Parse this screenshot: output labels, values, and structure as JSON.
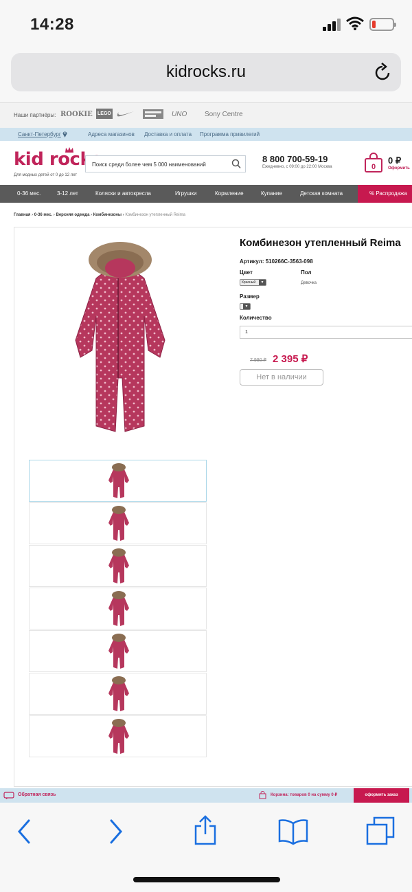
{
  "status": {
    "time": "14:28"
  },
  "browser": {
    "url": "kidrocks.ru"
  },
  "partners": {
    "label": "Наши партнёры:",
    "brands": [
      "ROOKIE",
      "LEGO",
      "UNO",
      "Sony Centre"
    ]
  },
  "infobar": {
    "city": "Санкт-Петербург",
    "links": [
      "Адреса магазинов",
      "Доставка и оплата",
      "Программа привилегий"
    ]
  },
  "header": {
    "logo": "kid rocks",
    "logo_sub": "Для модных детей от 0 до 12 лет",
    "search_placeholder": "Поиск среди более чем 5 000 наименований",
    "phone": "8 800 700-59-19",
    "hours": "Ежедневно, с 09:00 до 22:00 Москва",
    "cart_count": "0",
    "cart_amount": "0 ₽",
    "cart_link": "Оформить"
  },
  "nav": {
    "items": [
      "0-36 мес.",
      "3-12 лет",
      "Коляски и автокресла",
      "Игрушки",
      "Кормление",
      "Купание",
      "Детская комната"
    ],
    "sale": "% Распродажа"
  },
  "breadcrumbs": {
    "items": [
      "Главная",
      "0-36 мес.",
      "Верхняя одежда",
      "Комбинезоны"
    ],
    "current": "Комбинезон утепленный Reima"
  },
  "product": {
    "title": "Комбинезон утепленный Reima",
    "sku": "Артикул: 510266C-3563-098",
    "color_label": "Цвет",
    "color_value": "Красный",
    "gender_label": "Пол",
    "gender_value": "Девочка",
    "size_label": "Размер",
    "qty_label": "Количество",
    "qty_value": "1",
    "old_price": "7 990 ₽",
    "price": "2 395 ₽",
    "availability_button": "Нет в наличии",
    "thumbnail_count": 7
  },
  "sitebar": {
    "feedback": "Обратная связь",
    "cart_info": "Корзина: товаров 0 на сумму 0 ₽",
    "checkout": "оформить заказ"
  },
  "colors": {
    "brand": "#c0245a",
    "accent": "#c7194f",
    "nav_bg": "#5a5a5a",
    "info_bg": "#cfe3ef",
    "ios_blue": "#1a6fe0"
  },
  "icons": [
    "signal-icon",
    "wifi-icon",
    "battery-icon",
    "reload-icon",
    "location-pin-icon",
    "search-icon",
    "shopping-bag-icon",
    "feedback-icon",
    "cart-icon",
    "back-icon",
    "forward-icon",
    "share-icon",
    "bookmarks-icon",
    "tabs-icon"
  ]
}
